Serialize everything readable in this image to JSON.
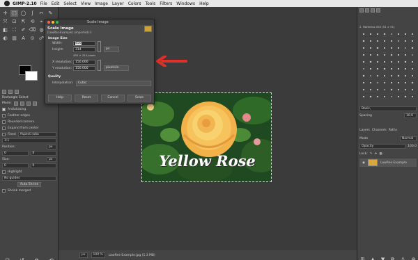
{
  "menubar": {
    "app_name": "GIMP-2.10",
    "items": [
      "File",
      "Edit",
      "Select",
      "View",
      "Image",
      "Layer",
      "Colors",
      "Tools",
      "Filters",
      "Windows",
      "Help"
    ],
    "window_title": "[LowRes-Example] (imported)-3.0 (RGB color 8-bit gamma integer, Display P3, 1 layer) 450x314 – GIMP"
  },
  "toolbox": {
    "tools": [
      "✛",
      "⬚",
      "◯",
      "ʃ",
      "✂",
      "✎",
      "⤧",
      "⊡",
      "⇱",
      "⟲",
      "⌖",
      "✚",
      "◧",
      "⛶",
      "✐",
      "⌫",
      "◍",
      "✱",
      "◐",
      "▥",
      "A",
      "⊙",
      "☍",
      "⊘"
    ],
    "options_title": "Rectangle Select",
    "mode_label": "Mode:",
    "antialiasing": "Antialiasing",
    "feather_edges": "Feather edges",
    "rounded_corners": "Rounded corners",
    "expand_center": "Expand from center",
    "fixed_label": "Fixed",
    "fixed_value": "Aspect ratio",
    "ratio_value": "1:1",
    "position_label": "Position:",
    "position_unit": "px",
    "pos_x": "0",
    "pos_y": "0",
    "size_label": "Size:",
    "size_unit": "px",
    "size_x": "0",
    "size_y": "0",
    "highlight": "Highlight",
    "guides_value": "No guides",
    "auto_shrink": "Auto Shrink",
    "shrink_merged": "Shrink merged"
  },
  "dialog": {
    "title": "Scale Image",
    "heading": "Scale Image",
    "subheading": "[LowRes-Example] (imported)-3",
    "image_size_label": "Image Size",
    "width_label": "Width:",
    "width_value": "450",
    "height_label": "Height:",
    "height_value": "314",
    "size_unit": "px",
    "dims_note": "450 × 314 pixels",
    "xres_label": "X resolution:",
    "xres_value": "150.000",
    "yres_label": "Y resolution:",
    "yres_value": "150.000",
    "res_unit": "pixels/in",
    "quality_label": "Quality",
    "interp_label": "Interpolation:",
    "interp_value": "Cubic",
    "help_button": "Help",
    "reset_button": "Reset",
    "cancel_button": "Cancel",
    "scale_button": "Scale"
  },
  "image": {
    "caption": "Yellow Rose"
  },
  "status": {
    "unit": "px",
    "zoom": "100 %",
    "file_info": "LowRes-Example.jpg (1.3 MB)"
  },
  "right_panel": {
    "brush_name": "2. Hardness 050 (51 × 51)",
    "brush_tag": "Basic,",
    "spacing_label": "Spacing",
    "spacing_value": "10.0",
    "tabs": [
      "Layers",
      "Channels",
      "Paths"
    ],
    "mode_label": "Mode",
    "mode_value": "Normal",
    "opacity_label": "Opacity",
    "opacity_value": "100.0",
    "lock_label": "Lock:",
    "layer_name": "LowRes-Example"
  },
  "colors": {
    "arrow": "#e0302a",
    "foreground": "#000000",
    "background": "#ffffff",
    "traffic_close": "#ff5f57",
    "traffic_min": "#febc2e",
    "traffic_max": "#28c840"
  }
}
